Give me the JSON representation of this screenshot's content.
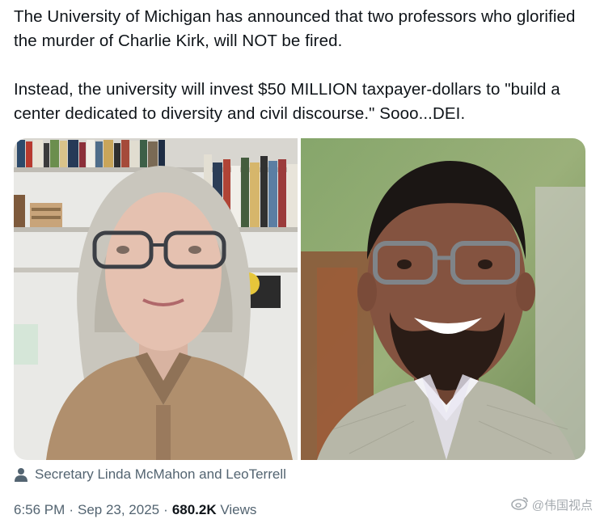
{
  "post": {
    "paragraph_1": "The University of Michigan has announced that two professors who glorified the murder of Charlie Kirk, will NOT be fired.",
    "paragraph_2": "Instead, the university will invest $50 MILLION taxpayer-dollars to \"build a center dedicated to diversity and civil discourse.\" Sooo...DEI."
  },
  "media": {
    "left_photo": "woman-with-glasses-bookshelf",
    "right_photo": "man-with-glasses-smiling"
  },
  "tagged": {
    "icon": "person-icon",
    "text": "Secretary Linda McMahon and LeoTerrell"
  },
  "meta": {
    "time": "6:56 PM",
    "date": "Sep 23, 2025",
    "views_count": "680.2K",
    "views_label": "Views"
  },
  "watermark": {
    "text": "@伟国视点",
    "icon": "weibo-icon"
  }
}
